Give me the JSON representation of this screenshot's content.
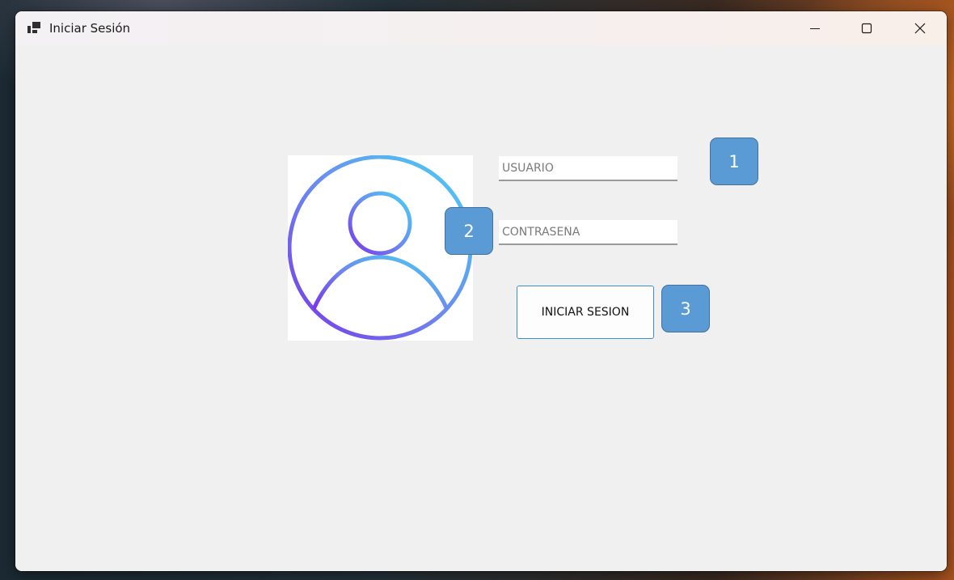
{
  "window": {
    "title": "Iniciar Sesión",
    "icon": "app-window-icon",
    "controls": {
      "minimize_icon": "minimize-icon",
      "maximize_icon": "maximize-icon",
      "close_icon": "close-icon"
    }
  },
  "login": {
    "avatar_icon": "user-avatar-icon",
    "username": {
      "value": "",
      "placeholder": "USUARIO"
    },
    "password": {
      "value": "",
      "placeholder": "CONTRASEÑA"
    },
    "submit_label": "INICIAR SESION"
  },
  "annotations": {
    "badge_1": "1",
    "badge_2": "2",
    "badge_3": "3"
  },
  "colors": {
    "badge_fill": "#5b9bd5",
    "badge_border": "#41719c",
    "button_border": "#3b8ed0",
    "avatar_gradient_start": "#49d2f2",
    "avatar_gradient_end": "#7a35e8"
  }
}
